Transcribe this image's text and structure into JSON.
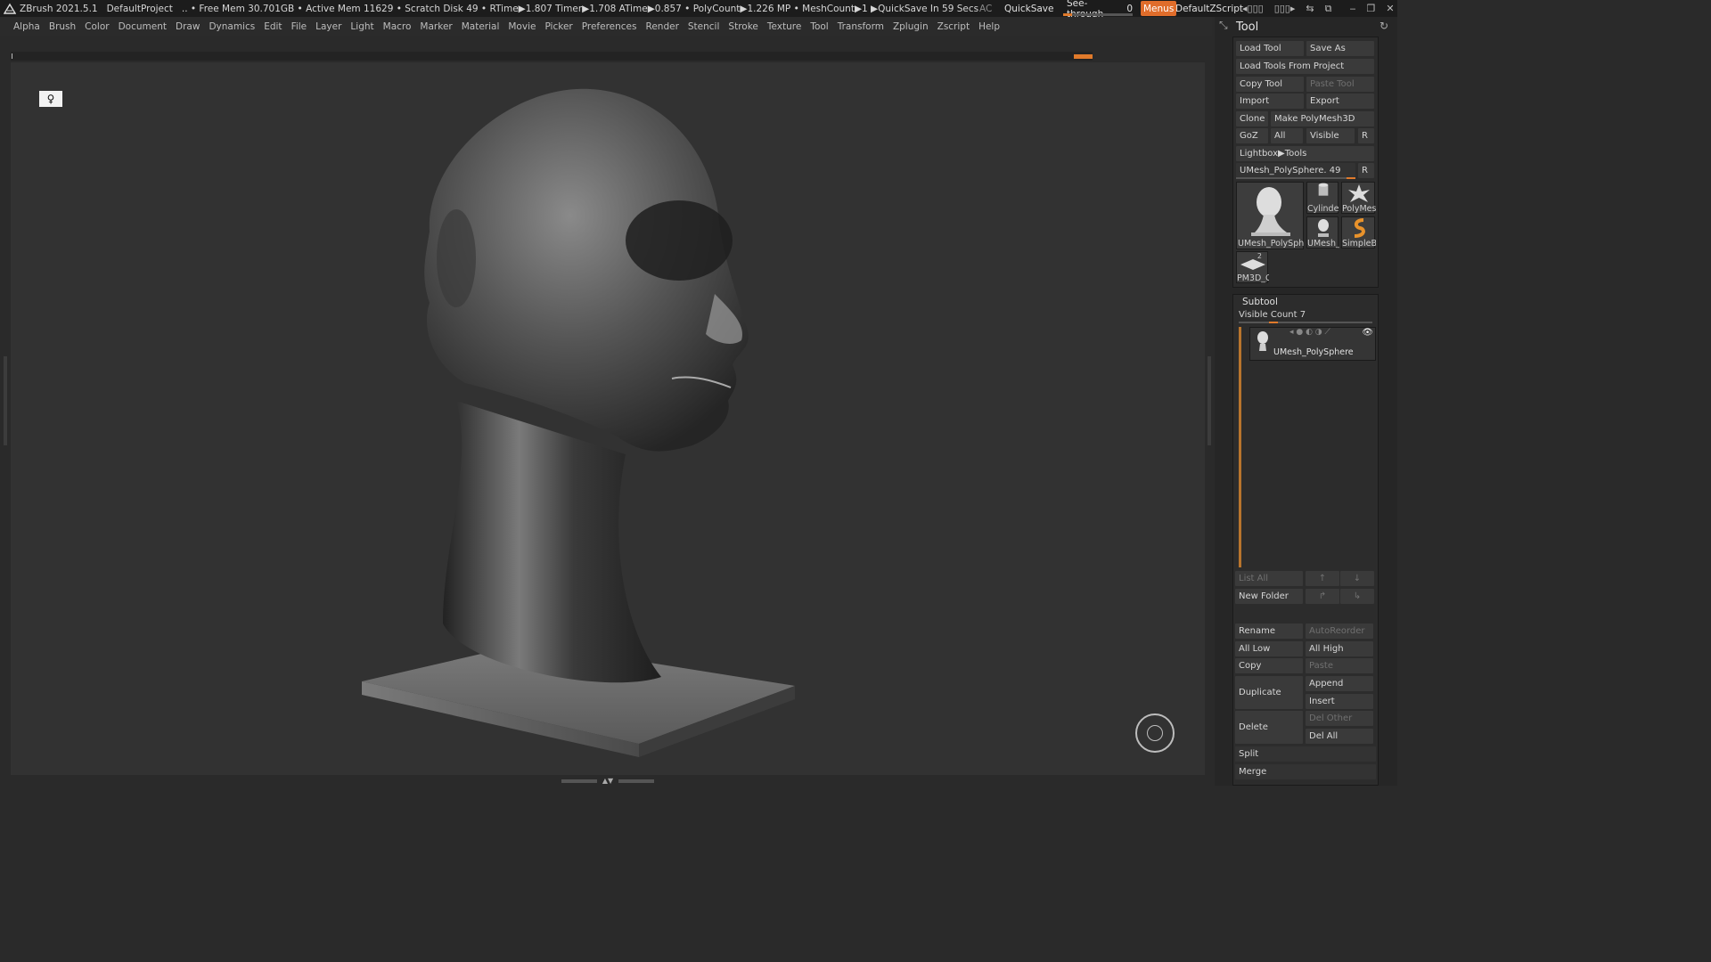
{
  "titlebar": {
    "app": "ZBrush 2021.5.1",
    "project": "DefaultProject",
    "stats": ".. • Free Mem 30.701GB • Active Mem 11629 • Scratch Disk 49 •  RTime▶1.807 Timer▶1.708 ATime▶0.857 • PolyCount▶1.226 MP  • MeshCount▶1  ▶QuickSave In 59 Secs",
    "ac": "AC",
    "quicksave": "QuickSave",
    "seethrough_label": "See-through",
    "seethrough_value": "0",
    "menus": "Menus",
    "default_zscript": "DefaultZScript"
  },
  "menubar": [
    "Alpha",
    "Brush",
    "Color",
    "Document",
    "Draw",
    "Dynamics",
    "Edit",
    "File",
    "Layer",
    "Light",
    "Macro",
    "Marker",
    "Material",
    "Movie",
    "Picker",
    "Preferences",
    "Render",
    "Stencil",
    "Stroke",
    "Texture",
    "Tool",
    "Transform",
    "Zplugin",
    "Zscript",
    "Help"
  ],
  "panel": {
    "title": "Tool",
    "load_tool": "Load Tool",
    "save_as": "Save As",
    "load_tools_from_project": "Load Tools From Project",
    "copy_tool": "Copy Tool",
    "paste_tool": "Paste Tool",
    "import": "Import",
    "export": "Export",
    "clone": "Clone",
    "make_polymesh3d": "Make PolyMesh3D",
    "goz": "GoZ",
    "all": "All",
    "visible": "Visible",
    "r": "R",
    "lightbox_tools": "Lightbox▶Tools",
    "current_tool": "UMesh_PolySphere. 49",
    "thumbs": {
      "main": "UMesh_PolySphe",
      "cylinder": "Cylinder",
      "polymesh": "PolyMes",
      "umesh": "UMesh_",
      "simpleb": "SimpleB",
      "pm3d": "PM3D_C",
      "pm3d_count": "2"
    },
    "subtool": {
      "header": "Subtool",
      "visible_count": "Visible Count 7",
      "item_name": "UMesh_PolySphere",
      "list_all": "List All",
      "new_folder": "New Folder",
      "rename": "Rename",
      "autoreorder": "AutoReorder",
      "all_low": "All Low",
      "all_high": "All High",
      "copy": "Copy",
      "paste": "Paste",
      "duplicate": "Duplicate",
      "append": "Append",
      "insert": "Insert",
      "delete": "Delete",
      "del_other": "Del Other",
      "del_all": "Del All",
      "split": "Split",
      "merge": "Merge"
    }
  },
  "colors": {
    "accent": "#e07a2b",
    "bg": "#323232",
    "panel": "#262626"
  }
}
